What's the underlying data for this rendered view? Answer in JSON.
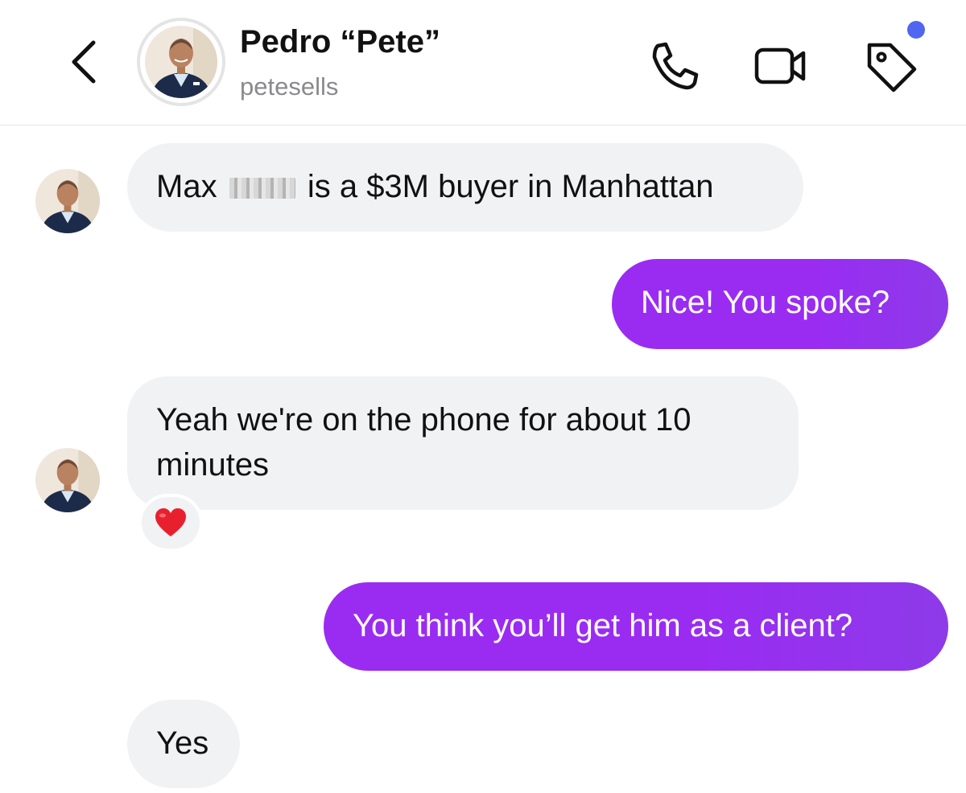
{
  "header": {
    "contact_name": "Pedro “Pete”",
    "contact_handle": "petesells",
    "accent_dot_color": "#4f66f0",
    "icons": [
      "back-chevron-icon",
      "phone-icon",
      "video-camera-icon",
      "tag-icon"
    ]
  },
  "messages": [
    {
      "direction": "incoming",
      "text_before": "Max",
      "redacted": true,
      "text_after": "is a $3M buyer in Manhattan"
    },
    {
      "direction": "outgoing",
      "text": "Nice! You spoke?"
    },
    {
      "direction": "incoming",
      "text": "Yeah we're on the phone for about 10 minutes",
      "reaction": "heart"
    },
    {
      "direction": "outgoing",
      "text": "You think you’ll get him as a client?"
    },
    {
      "direction": "incoming",
      "text": "Yes"
    }
  ],
  "colors": {
    "outgoing_bubble": "#9a2cf2",
    "incoming_bubble": "#f1f2f4",
    "reaction_heart": "#e8202e"
  }
}
